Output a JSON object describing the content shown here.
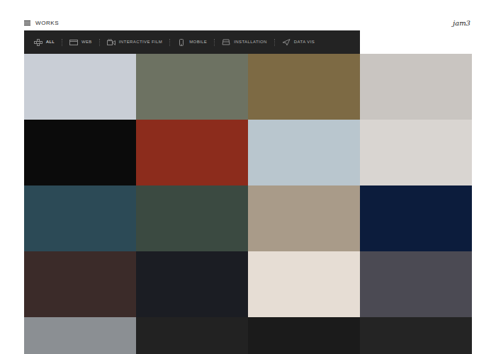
{
  "header": {
    "menu_label": "WORKS",
    "logo": "jam3"
  },
  "filters": [
    {
      "label": "ALL",
      "selected": true
    },
    {
      "label": "WEB",
      "selected": false
    },
    {
      "label": "INTERACTIVE FILM",
      "selected": false
    },
    {
      "label": "MOBILE",
      "selected": false
    },
    {
      "label": "INSTALLATION",
      "selected": false
    },
    {
      "label": "DATA VIS",
      "selected": false
    }
  ],
  "works": [
    {
      "color": "#c9ced6"
    },
    {
      "color": "#6d7262"
    },
    {
      "color": "#7d6a44"
    },
    {
      "color": "#c9c5c1"
    },
    {
      "color": "#0b0b0b"
    },
    {
      "color": "#8c2c1c"
    },
    {
      "color": "#b9c6ce"
    },
    {
      "color": "#d9d5d1"
    },
    {
      "color": "#2c4a56"
    },
    {
      "color": "#3b4a41"
    },
    {
      "color": "#a99b89"
    },
    {
      "color": "#0c1c3c"
    },
    {
      "color": "#3b2b29"
    },
    {
      "color": "#1b1d23"
    },
    {
      "color": "#e6ddd4"
    },
    {
      "color": "#4b4a53"
    },
    {
      "color": "#8b8f93"
    },
    {
      "color": "#222222"
    },
    {
      "color": "#1b1b1b"
    },
    {
      "color": "#242424"
    }
  ]
}
